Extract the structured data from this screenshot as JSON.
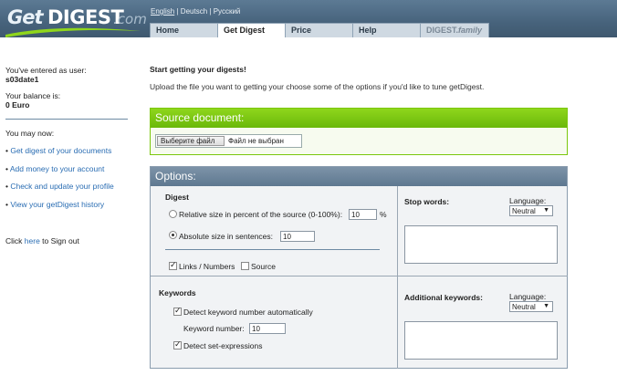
{
  "header": {
    "logo": {
      "get": "Get",
      "digest": "DIGEST",
      "com": ".com"
    },
    "languages": [
      "English",
      "Deutsch",
      "Русский"
    ],
    "tabs": [
      "Home",
      "Get Digest",
      "Price",
      "Help",
      "DIGEST.family"
    ],
    "tab_family": {
      "prefix": "DIGEST.",
      "suffix": "family"
    }
  },
  "sidebar": {
    "entered_label": "You've entered as user:",
    "username": "s03date1",
    "balance_label": "Your balance is:",
    "balance": "0 Euro",
    "may_now": "You may now:",
    "links": [
      "Get digest of your documents",
      "Add money to your account",
      "Check and update your profile",
      "View your getDigest history"
    ],
    "signout_pre": "Click ",
    "signout_here": "here",
    "signout_post": " to Sign out"
  },
  "main": {
    "title": "Start getting your digests!",
    "intro": "Upload the file you want to getting your choose some of the options if you'd like to tune getDigest."
  },
  "source": {
    "heading": "Source document:",
    "file_button": "Выберите файл",
    "file_status": "Файл не выбран"
  },
  "options": {
    "heading": "Options:",
    "digest_label": "Digest",
    "relative_label": "Relative size in percent of the source (0-100%):",
    "relative_value": "10",
    "percent": "%",
    "absolute_label": "Absolute size in sentences:",
    "absolute_value": "10",
    "links_numbers": "Links / Numbers",
    "source": "Source",
    "stop_words": "Stop words:",
    "language_label": "Language:",
    "language_value": "Neutral",
    "keywords_label": "Keywords",
    "detect_keyword": "Detect keyword number automatically",
    "keyword_number_label": "Keyword number:",
    "keyword_number_value": "10",
    "detect_set": "Detect set-expressions",
    "additional_keywords": "Additional keywords:",
    "language_label2": "Language:",
    "language_value2": "Neutral"
  }
}
